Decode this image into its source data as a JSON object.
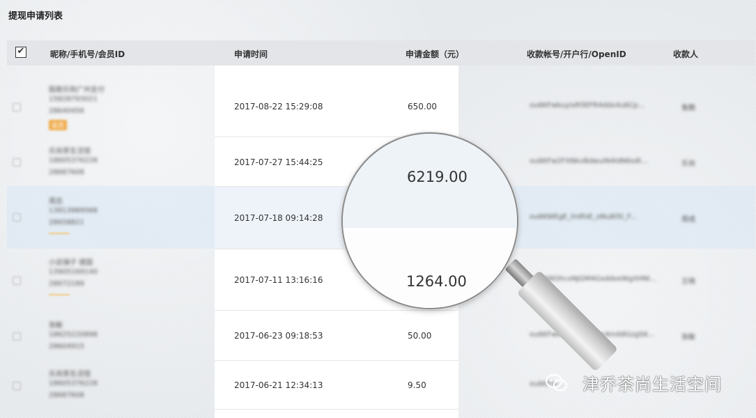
{
  "page": {
    "title": "提现申请列表"
  },
  "table": {
    "headers": {
      "select_all": "✔",
      "member": "昵称/手机号/会员ID",
      "time": "申请时间",
      "amount": "申请金额（元）",
      "account": "收款帐号/开户行/OpenID",
      "payee": "收款人"
    },
    "rows": [
      {
        "time": "2017-08-22 15:29:08",
        "amount": "650.00",
        "member": [
          "殷歌乐购广州支付",
          "15828793021",
          "28640456"
        ],
        "badge": "会员",
        "account": "ou6KFwkuyIxR5EFR4ddx4u6Cp...",
        "payee": "鲁鹏"
      },
      {
        "time": "2017-07-27 15:44:25",
        "amount": "",
        "member": [
          "乐尚茶生活馆",
          "18605376228",
          "28687608"
        ],
        "badge": "",
        "account": "ou6KFw2FXNkvBdwuiN4ldN6sdt...",
        "payee": "乐尚"
      },
      {
        "time": "2017-07-18 09:14:28",
        "amount": "",
        "member": [
          "周志",
          "13913989568",
          "28658821"
        ],
        "badge": "",
        "account": "ou6KWEgE_ilrdfoE_oNu8i5t_F...",
        "payee": "周成"
      },
      {
        "time": "2017-07-11 13:16:16",
        "amount": "",
        "member": [
          "小店铺子 德国",
          "13905169140",
          "28672189"
        ],
        "badge": "",
        "account": "ou6KWOhcxNJGM4GxddoxWgXHNl...",
        "payee": "王晓"
      },
      {
        "time": "2017-06-23 09:18:53",
        "amount": "50.00",
        "member": [
          "张敏",
          "18625220898",
          "28604915"
        ],
        "badge": "",
        "account": "ou6KFwkN4ylIxyWhm4mA8GzgS6...",
        "payee": "张敏"
      },
      {
        "time": "2017-06-21 12:34:13",
        "amount": "9.50",
        "member": [
          "乐尚茶生活馆",
          "18605376228",
          "28687608"
        ],
        "badge": "",
        "account": "ou6KFw...",
        "payee": "乐尚"
      }
    ]
  },
  "magnifier": {
    "value_top": "6219.00",
    "value_bottom": "1264.00"
  },
  "watermark": {
    "text": "津乔茶尚生活空间",
    "icon": "wechat-icon"
  }
}
